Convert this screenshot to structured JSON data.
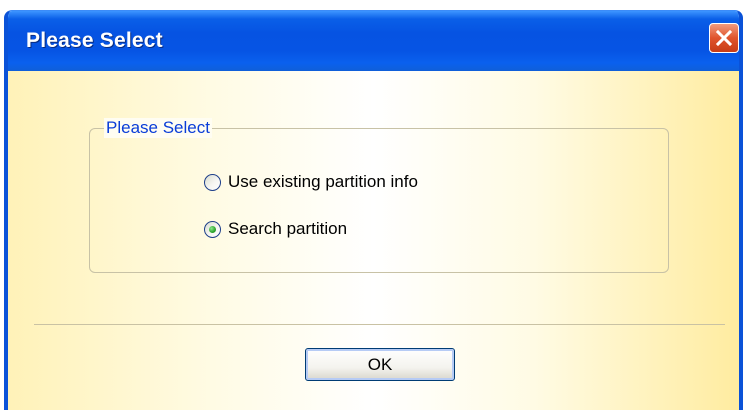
{
  "window": {
    "title": "Please Select",
    "close_label": "Close"
  },
  "group": {
    "legend": "Please Select",
    "options": [
      {
        "label": "Use existing partition info",
        "selected": false
      },
      {
        "label": "Search partition",
        "selected": true
      }
    ]
  },
  "buttons": {
    "ok_label": "OK"
  },
  "colors": {
    "titlebar": "#0654e4",
    "legend_text": "#0a3dd8",
    "close_button": "#e0542c",
    "selected_radio": "#2ca52c"
  },
  "icons": {
    "close": "close-icon"
  }
}
